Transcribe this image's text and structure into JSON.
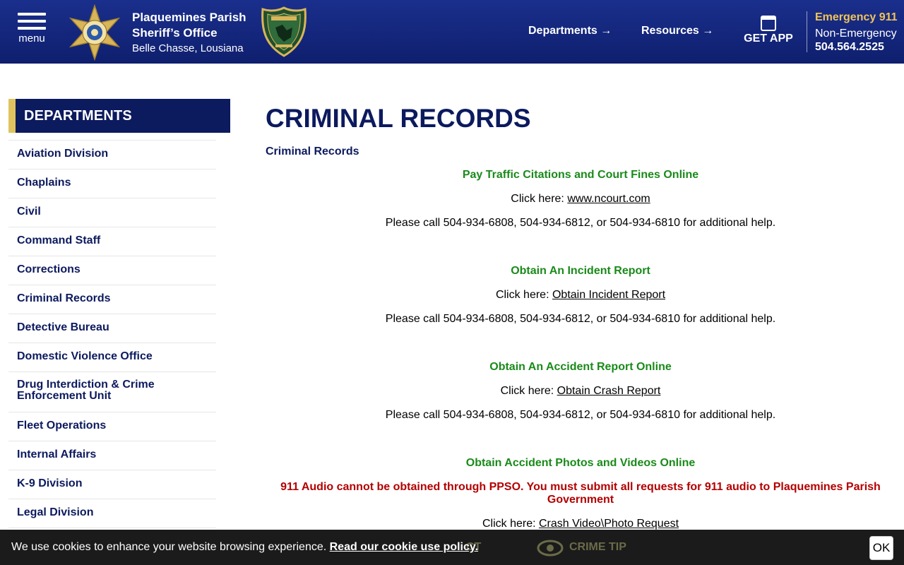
{
  "header": {
    "menu_label": "menu",
    "brand_line1": "Plaquemines Parish",
    "brand_line2": "Sheriff’s Office",
    "brand_line3": "Belle Chasse, Lousiana",
    "nav": [
      {
        "label": "Departments →"
      },
      {
        "label": "Resources →"
      }
    ],
    "get_app": "GET APP",
    "emergency_label": "Emergency 911",
    "non_emergency_label": "Non-Emergency",
    "non_emergency_phone": "504.564.2525",
    "colors": {
      "header_bg": "#13268a",
      "accent_gold": "#f0c35a"
    }
  },
  "sidebar": {
    "title": "DEPARTMENTS",
    "items": [
      {
        "label": "Aviation Division"
      },
      {
        "label": "Chaplains"
      },
      {
        "label": "Civil"
      },
      {
        "label": "Command Staff"
      },
      {
        "label": "Corrections"
      },
      {
        "label": "Criminal Records"
      },
      {
        "label": "Detective Bureau"
      },
      {
        "label": "Domestic Violence Office"
      },
      {
        "label": "Drug Interdiction & Crime",
        "label2": "Enforcement Unit"
      },
      {
        "label": "Fleet Operations"
      },
      {
        "label": "Internal Affairs"
      },
      {
        "label": "K-9 Division"
      },
      {
        "label": "Legal Division"
      }
    ]
  },
  "main": {
    "title": "CRIMINAL RECORDS",
    "breadcrumb": "Criminal Records",
    "sections": [
      {
        "heading": "Pay Traffic Citations and Court Fines Online",
        "click_prefix": "Click here: ",
        "link": "www.ncourt.com",
        "help": "Please call 504-934-6808, 504-934-6812, or 504-934-6810 for additional help."
      },
      {
        "heading": "Obtain An Incident Report",
        "click_prefix": "Click here: ",
        "link": "Obtain Incident Report",
        "help": "Please call 504-934-6808, 504-934-6812, or 504-934-6810 for additional help."
      },
      {
        "heading": "Obtain An Accident Report Online",
        "click_prefix": "Click here: ",
        "link": "Obtain Crash Report",
        "help": "Please call 504-934-6808, 504-934-6812, or 504-934-6810 for additional help."
      },
      {
        "heading": "Obtain Accident Photos and Videos Online",
        "notice": "911 Audio cannot be obtained through PPSO. You must submit all requests for 911 audio to Plaquemines Parish Government",
        "click_prefix": "Click here: ",
        "link": "Crash Video\\Photo Request"
      }
    ]
  },
  "footer_bar": {
    "ghost_contact": "CT",
    "ghost_tip": "CRIME TIP"
  },
  "cookie": {
    "text": "We use cookies to enhance your website browsing experience. ",
    "link": "Read our cookie use policy.",
    "ok": "OK"
  }
}
